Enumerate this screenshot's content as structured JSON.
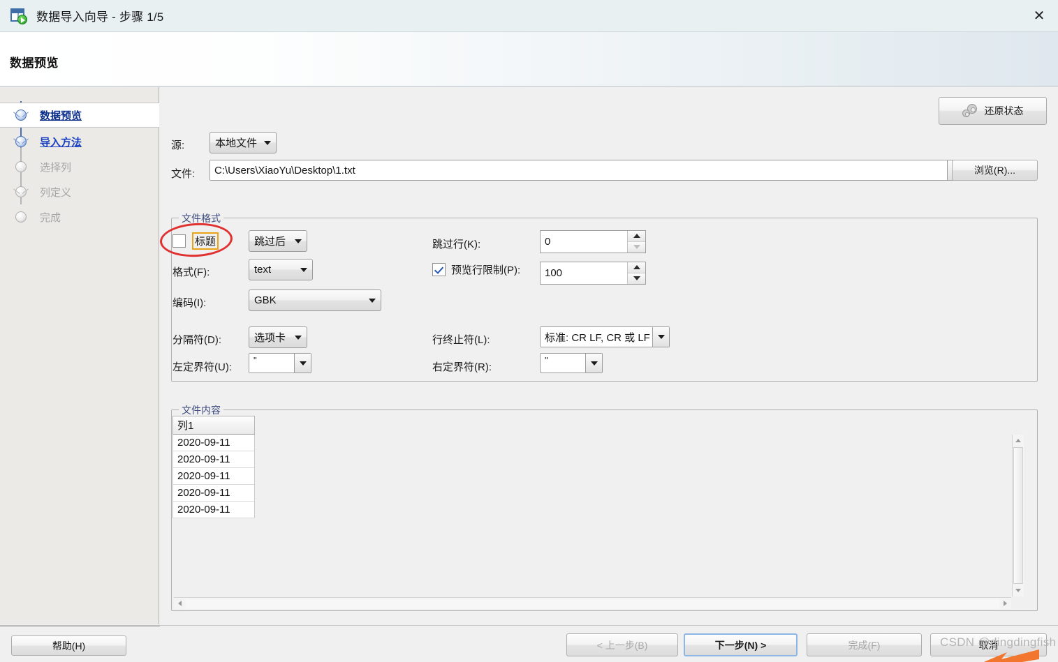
{
  "window": {
    "title": "数据导入向导 - 步骤 1/5",
    "icon": "import-wizard-icon",
    "close_label": "✕"
  },
  "header": {
    "title": "数据预览"
  },
  "sidebar": {
    "steps": [
      {
        "label": "数据预览",
        "state": "active"
      },
      {
        "label": "导入方法",
        "state": "link"
      },
      {
        "label": "选择列",
        "state": "disabled"
      },
      {
        "label": "列定义",
        "state": "disabled"
      },
      {
        "label": "完成",
        "state": "disabled"
      }
    ]
  },
  "main": {
    "restore_button": "还原状态",
    "source": {
      "label": "源:",
      "value": "本地文件"
    },
    "file": {
      "label": "文件:",
      "value": "C:\\Users\\XiaoYu\\Desktop\\1.txt",
      "browse_button": "浏览(R)..."
    },
    "file_format": {
      "title": "文件格式",
      "title_checkbox": {
        "label": "标题",
        "checked": false
      },
      "title_mode": "跳过后",
      "format": {
        "label": "格式(F):",
        "value": "text"
      },
      "encoding": {
        "label": "编码(I):",
        "value": "GBK"
      },
      "delimiter": {
        "label": "分隔符(D):",
        "value": "选项卡"
      },
      "left_quote": {
        "label": "左定界符(U):",
        "value": "\""
      },
      "skip_rows": {
        "label": "跳过行(K):",
        "value": "0"
      },
      "preview_limit": {
        "label": "预览行限制(P):",
        "value": "100",
        "checked": true
      },
      "line_terminator": {
        "label": "行终止符(L):",
        "value": "标准: CR LF, CR 或 LF"
      },
      "right_quote": {
        "label": "右定界符(R):",
        "value": "\""
      }
    },
    "file_content": {
      "title": "文件内容",
      "columns": [
        "列1"
      ],
      "rows": [
        [
          "2020-09-11"
        ],
        [
          "2020-09-11"
        ],
        [
          "2020-09-11"
        ],
        [
          "2020-09-11"
        ],
        [
          "2020-09-11"
        ]
      ]
    }
  },
  "footer": {
    "help": "帮助(H)",
    "back": "< 上一步(B)",
    "next": "下一步(N) >",
    "finish": "完成(F)",
    "cancel": "取消"
  },
  "watermark": {
    "text": "CSDN @dingdingfish"
  },
  "colors": {
    "accent_blue": "#1a3fc0",
    "annotation_red": "#e03030",
    "focus_orange": "#e8a317",
    "titlebar_bg": "#e8f0f2"
  }
}
